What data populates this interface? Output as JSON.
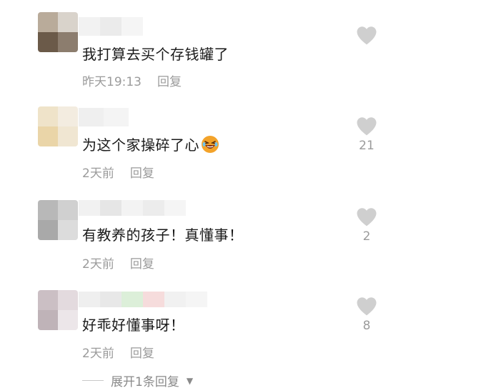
{
  "comments": [
    {
      "text": "我打算去买个存钱罐了",
      "time": "昨天19:13",
      "reply_label": "回复",
      "likes": ""
    },
    {
      "text": "为这个家操碎了心",
      "time": "2天前",
      "reply_label": "回复",
      "likes": "21"
    },
    {
      "text": "有教养的孩子！真懂事！",
      "time": "2天前",
      "reply_label": "回复",
      "likes": "2"
    },
    {
      "text": "好乖好懂事呀！",
      "time": "2天前",
      "reply_label": "回复",
      "likes": "8"
    }
  ],
  "expand_replies_label": "展开1条回复",
  "colors": {
    "text": "#1a1a1a",
    "meta": "#9b9b9b",
    "heart": "#cfcfcf",
    "emoji": "#f3a32a"
  },
  "icons": [
    "heart-icon",
    "laughing-emoji-icon",
    "caret-down-icon"
  ]
}
